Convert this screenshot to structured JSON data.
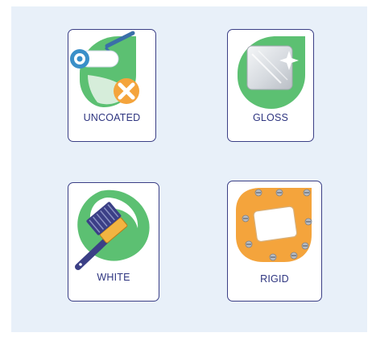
{
  "options": [
    {
      "label": "UNCOATED",
      "icon": "uncoated-roller-icon"
    },
    {
      "label": "GLOSS",
      "icon": "gloss-sheet-icon"
    },
    {
      "label": "WHITE",
      "icon": "white-brush-icon"
    },
    {
      "label": "RIGID",
      "icon": "rigid-board-icon"
    }
  ],
  "colors": {
    "green": "#5cc072",
    "orange": "#f4a43c",
    "navy": "#3b3f86",
    "card_border": "#3b3f86",
    "panel_bg": "#e8f0f9"
  }
}
